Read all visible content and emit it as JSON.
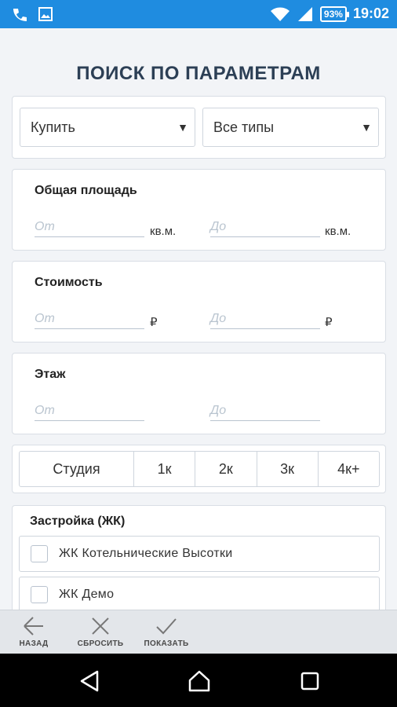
{
  "status_bar": {
    "battery": "93%",
    "time": "19:02"
  },
  "title": "ПОИСК ПО ПАРАМЕТРАМ",
  "filters": {
    "deal": "Купить",
    "type": "Все типы"
  },
  "area": {
    "label": "Общая площадь",
    "from_placeholder": "От",
    "to_placeholder": "До",
    "unit": "кв.м."
  },
  "price": {
    "label": "Стоимость",
    "from_placeholder": "От",
    "to_placeholder": "До",
    "unit": "₽"
  },
  "floor": {
    "label": "Этаж",
    "from_placeholder": "От",
    "to_placeholder": "До"
  },
  "rooms": [
    "Студия",
    "1к",
    "2к",
    "3к",
    "4к+"
  ],
  "complexes": {
    "label": "Застройка (ЖК)",
    "items": [
      "ЖК Котельнические Высотки",
      "ЖК Демо"
    ]
  },
  "toolbar": {
    "back": "НАЗАД",
    "reset": "СБРОСИТЬ",
    "show": "ПОКАЗАТЬ"
  }
}
